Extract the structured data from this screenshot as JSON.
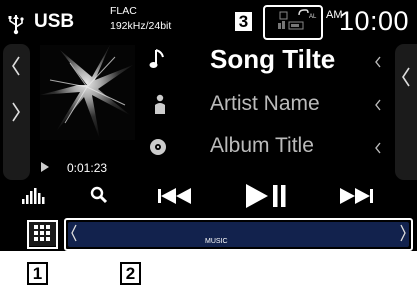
{
  "source": {
    "name": "USB"
  },
  "format": {
    "codec": "FLAC",
    "spec": "192kHz/24bit"
  },
  "clock": {
    "ampm": "AM",
    "time": "10:00"
  },
  "track": {
    "title": "Song Tilte",
    "artist": "Artist Name",
    "album": "Album Title",
    "elapsed": "0:01:23"
  },
  "bottom_bar": {
    "label": "MUSIC"
  },
  "callouts": {
    "menu": "1",
    "bar": "2",
    "indicator": "3"
  },
  "colors": {
    "background": "#000000",
    "bar": "#12224d",
    "text": "#ffffff"
  },
  "icons": [
    "usb-icon",
    "bluetooth-audio-icon",
    "phone-status-icon",
    "chevron-left-icon",
    "chevron-right-icon",
    "music-note-icon",
    "artist-icon",
    "album-icon",
    "play-small-icon",
    "equalizer-icon",
    "search-icon",
    "previous-track-icon",
    "play-pause-icon",
    "next-track-icon",
    "menu-grid-icon"
  ]
}
